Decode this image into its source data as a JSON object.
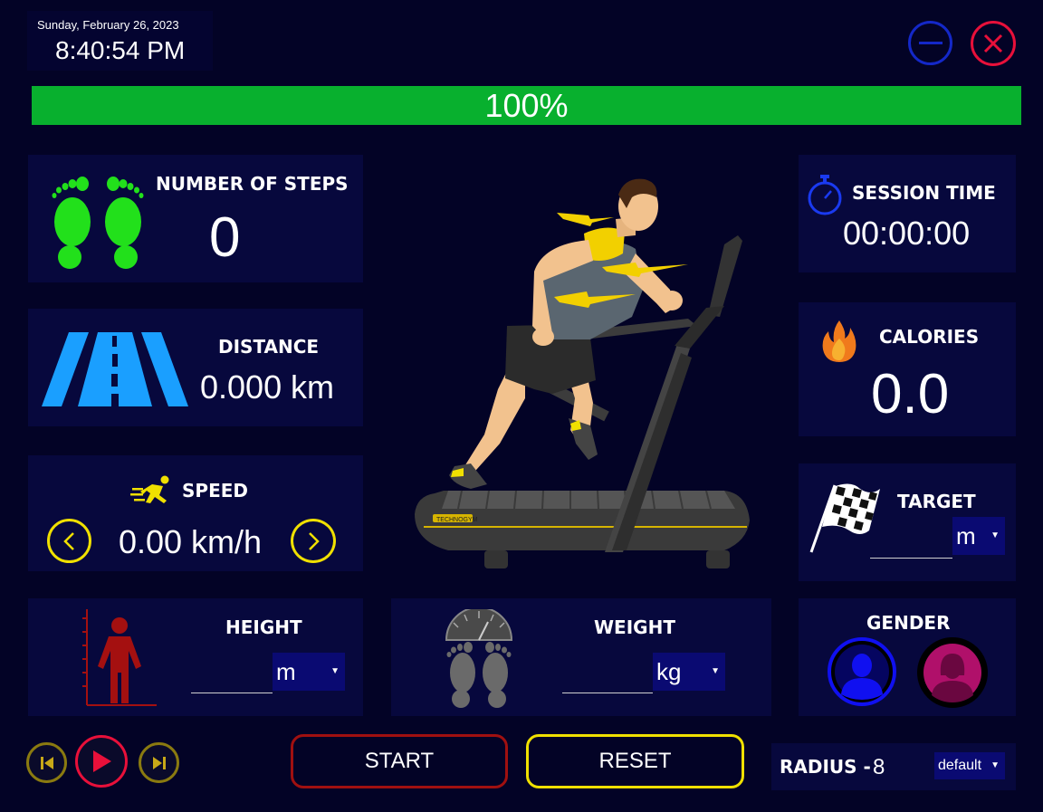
{
  "header": {
    "date": "Sunday, February 26, 2023",
    "time": "8:40:54 PM",
    "progress_label": "100%",
    "progress_fraction": 1.0
  },
  "steps": {
    "title": "NUMBER OF STEPS",
    "value": "0"
  },
  "distance": {
    "title": "DISTANCE",
    "value": "0.000",
    "unit": "km"
  },
  "speed": {
    "title": "SPEED",
    "value": "0.00",
    "unit": "km/h"
  },
  "height": {
    "title": "HEIGHT",
    "value": "",
    "unit": "m"
  },
  "weight": {
    "title": "WEIGHT",
    "value": "",
    "unit": "kg"
  },
  "session": {
    "title": "SESSION TIME",
    "value": "00:00:00"
  },
  "calories": {
    "title": "CALORIES",
    "value": "0.0"
  },
  "target": {
    "title": "TARGET",
    "value": "",
    "unit": "m"
  },
  "gender": {
    "title": "GENDER"
  },
  "controls": {
    "start_label": "START",
    "reset_label": "RESET"
  },
  "radius": {
    "label": "RADIUS -",
    "value": "8",
    "option": "default"
  },
  "colors": {
    "background": "#030326",
    "panel": "#07083d",
    "progress": "#08b02e",
    "accent_yellow": "#f0e000",
    "accent_red": "#e8103a",
    "steps_green": "#22e01b",
    "road_blue": "#1a9fff",
    "male_blue": "#1010f0",
    "female_pink": "#b0106a"
  },
  "icons": [
    "feet-icon",
    "road-icon",
    "runner-icon",
    "person-height-icon",
    "scale-feet-icon",
    "stopwatch-icon",
    "flame-icon",
    "checkered-flag-icon",
    "male-avatar-icon",
    "female-avatar-icon",
    "minimize-icon",
    "close-icon",
    "previous-icon",
    "play-icon",
    "next-icon",
    "chevron-left-icon",
    "chevron-right-icon"
  ]
}
